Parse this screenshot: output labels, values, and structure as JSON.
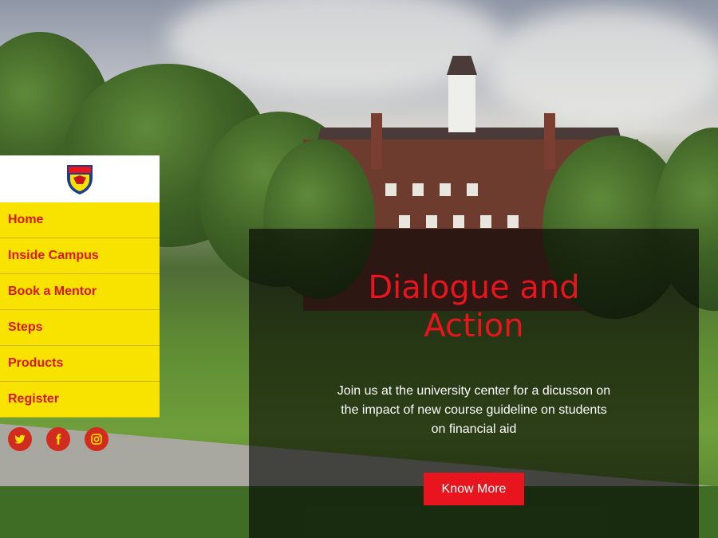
{
  "nav": {
    "items": [
      {
        "label": "Home"
      },
      {
        "label": "Inside Campus"
      },
      {
        "label": "Book a Mentor"
      },
      {
        "label": "Steps"
      },
      {
        "label": "Products"
      },
      {
        "label": "Register"
      }
    ]
  },
  "social": {
    "icons": [
      "twitter-icon",
      "facebook-icon",
      "instagram-icon"
    ]
  },
  "hero": {
    "heading_line1": "Dialogue and",
    "heading_line2": "Action",
    "text_line1": "Join us at the university center for a dicusson on",
    "text_line2": "the impact of new course guideline on students",
    "text_line3": "on financial aid",
    "button_label": "Know More"
  },
  "colors": {
    "accent": "#e8141e",
    "nav_background": "#f7e200",
    "icon_background": "#d22c1f"
  }
}
